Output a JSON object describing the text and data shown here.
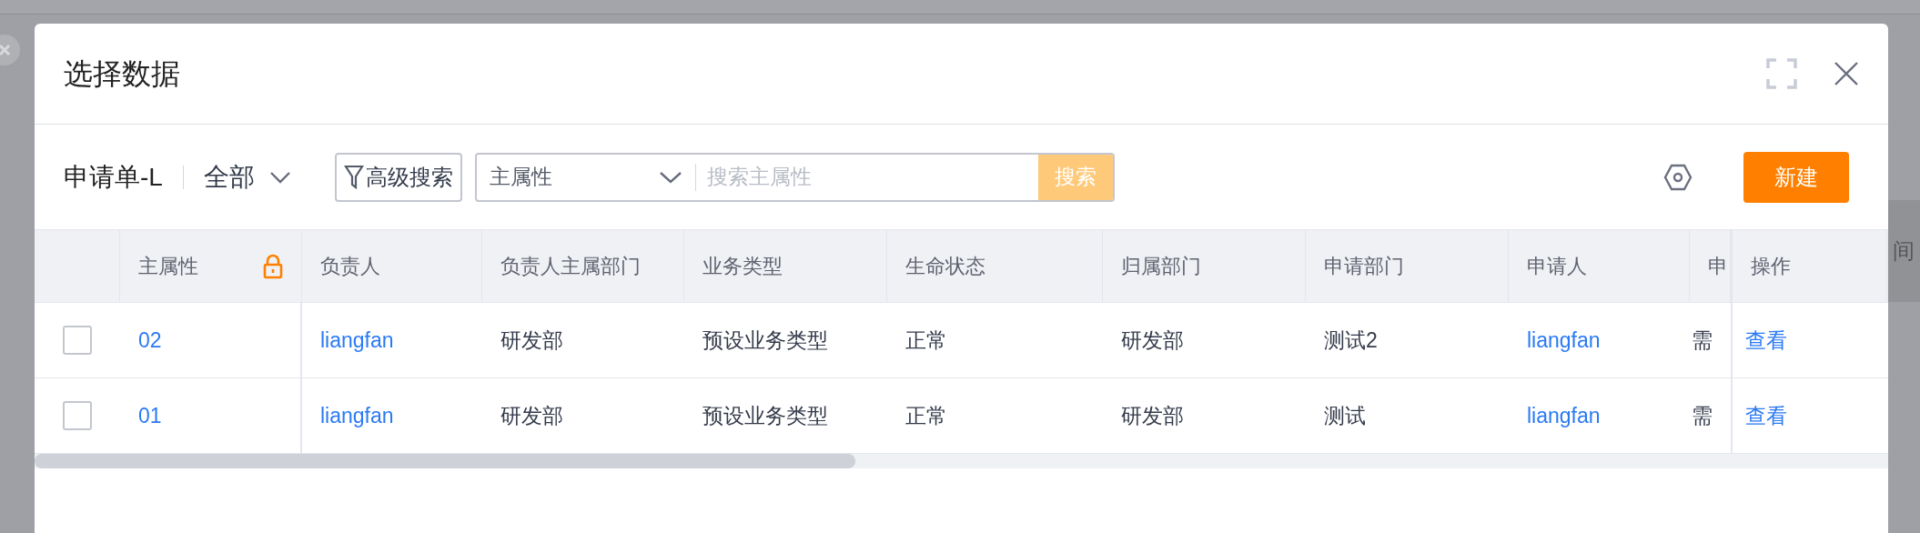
{
  "background": {
    "cut_text": "间"
  },
  "dialog": {
    "title": "选择数据"
  },
  "toolbar": {
    "object_name": "申请单-L",
    "view_filter": "全部",
    "advanced_search": "高级搜索",
    "search_scope": "主属性",
    "search": {
      "placeholder": "搜索主属性"
    },
    "search_button": "搜索",
    "new_button": "新建"
  },
  "table": {
    "columns": [
      {
        "label": "主属性",
        "kind": "link",
        "locked": true
      },
      {
        "label": "负责人",
        "kind": "link",
        "locked": false
      },
      {
        "label": "负责人主属部门",
        "kind": "text",
        "locked": false
      },
      {
        "label": "业务类型",
        "kind": "text",
        "locked": false
      },
      {
        "label": "生命状态",
        "kind": "text",
        "locked": false
      },
      {
        "label": "归属部门",
        "kind": "text",
        "locked": false
      },
      {
        "label": "申请部门",
        "kind": "text",
        "locked": false
      },
      {
        "label": "申请人",
        "kind": "link",
        "locked": false
      },
      {
        "label": "申",
        "kind": "text",
        "locked": false
      },
      {
        "label": "操作",
        "kind": "link",
        "locked": false
      }
    ],
    "rows": [
      {
        "checked": false,
        "cells": [
          "02",
          "liangfan",
          "研发部",
          "预设业务类型",
          "正常",
          "研发部",
          "测试2",
          "liangfan",
          "需",
          "查看"
        ]
      },
      {
        "checked": false,
        "cells": [
          "01",
          "liangfan",
          "研发部",
          "预设业务类型",
          "正常",
          "研发部",
          "测试",
          "liangfan",
          "需",
          "查看"
        ]
      }
    ]
  }
}
